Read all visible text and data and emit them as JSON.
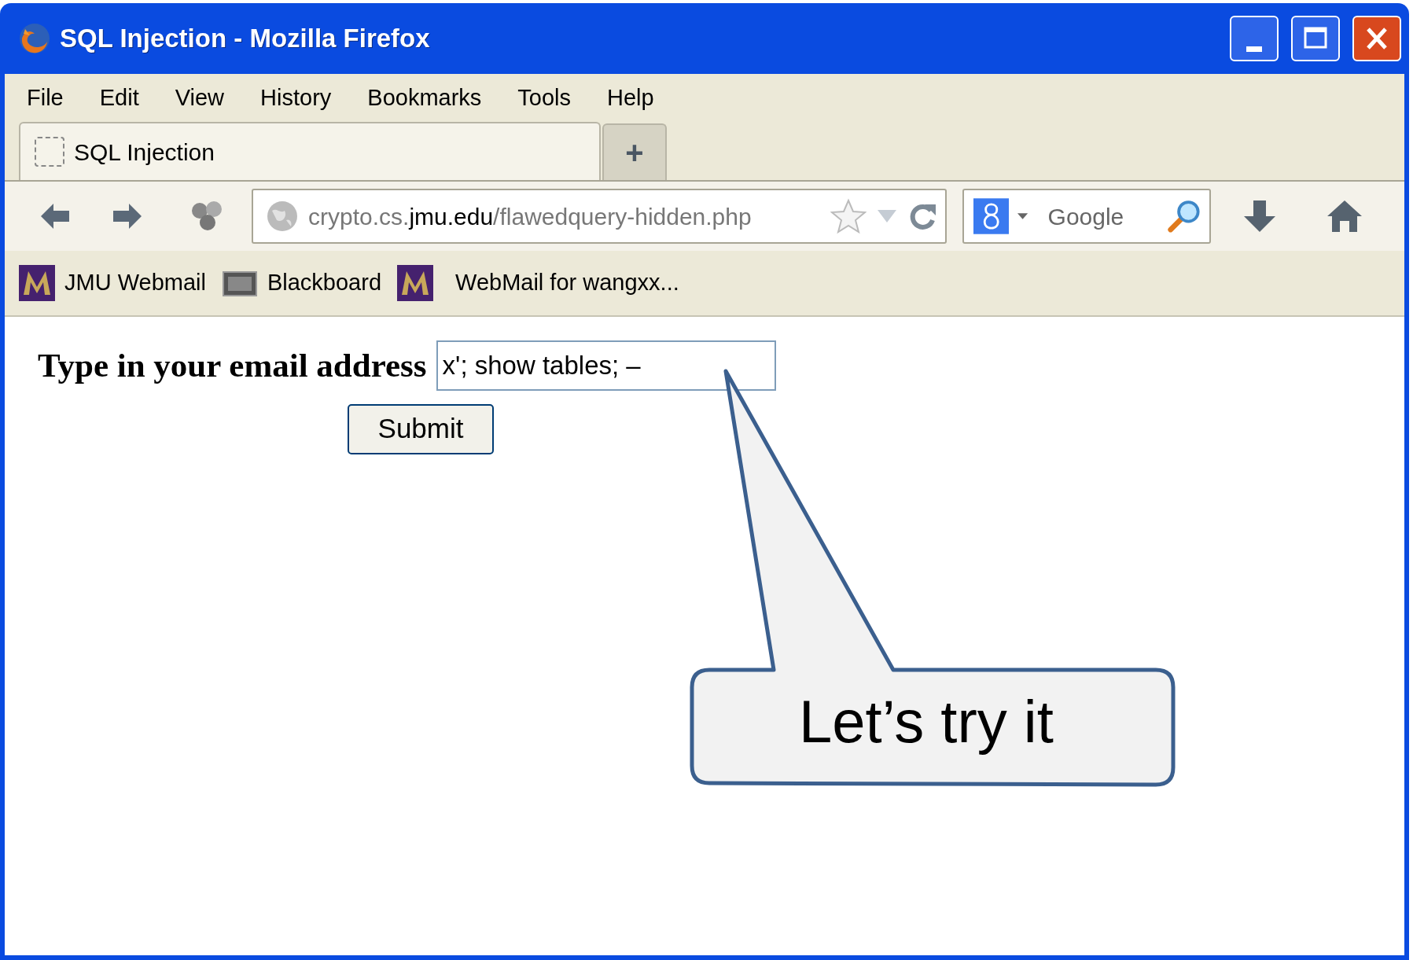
{
  "window": {
    "title": "SQL Injection - Mozilla Firefox"
  },
  "menu": [
    {
      "label": "File"
    },
    {
      "label": "Edit"
    },
    {
      "label": "View"
    },
    {
      "label": "History"
    },
    {
      "label": "Bookmarks"
    },
    {
      "label": "Tools"
    },
    {
      "label": "Help"
    }
  ],
  "tabs": [
    {
      "label": "SQL Injection",
      "selected": true
    }
  ],
  "new_tab": "+",
  "address": {
    "scheme_host": "crypto.cs.",
    "domain": "jmu.edu",
    "path": "/flawedquery-hidden.php"
  },
  "search": {
    "placeholder": "Google"
  },
  "bookmarks": [
    {
      "label": "JMU Webmail",
      "kind": "m"
    },
    {
      "label": "Blackboard",
      "kind": "bb"
    },
    {
      "label": "WebMail for wangxx...",
      "kind": "m"
    }
  ],
  "form": {
    "label": "Type in your email address",
    "value": "x'; show tables; –",
    "button": "Submit"
  },
  "callout": {
    "text": "Let’s try it"
  }
}
